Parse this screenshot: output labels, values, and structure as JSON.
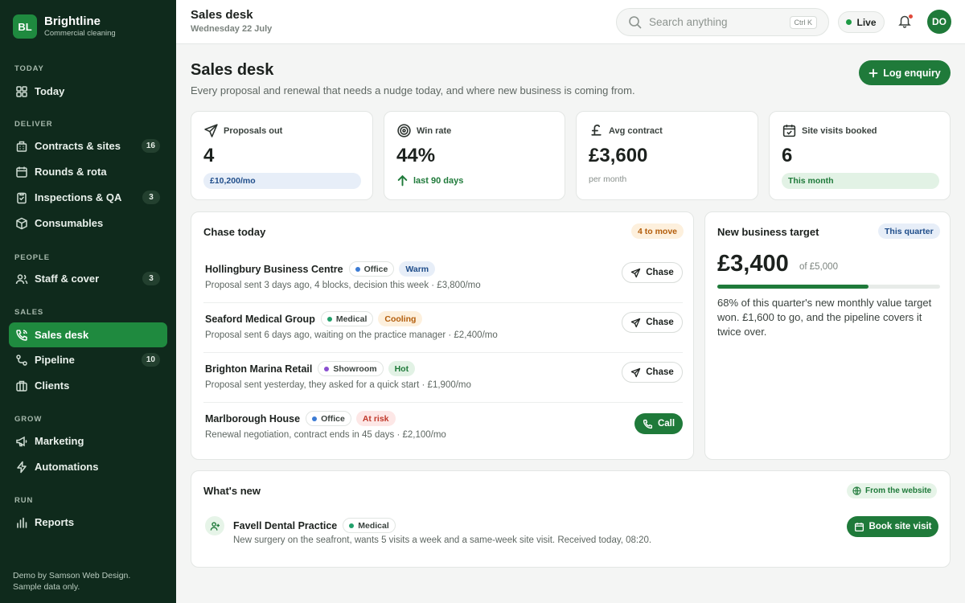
{
  "brand": {
    "initials": "BL",
    "name": "Brightline",
    "subtitle": "Commercial cleaning"
  },
  "sidebar": {
    "sections": [
      "TODAY",
      "DELIVER",
      "PEOPLE",
      "SALES",
      "GROW",
      "RUN"
    ],
    "items": [
      {
        "label": "Today",
        "icon": "grid-icon"
      },
      {
        "label": "Contracts & sites",
        "icon": "building-icon",
        "count": "16"
      },
      {
        "label": "Rounds & rota",
        "icon": "calendar-icon"
      },
      {
        "label": "Inspections & QA",
        "icon": "clipboard-icon",
        "count": "3"
      },
      {
        "label": "Consumables",
        "icon": "box-icon"
      },
      {
        "label": "Staff & cover",
        "icon": "users-icon",
        "count": "3"
      },
      {
        "label": "Sales desk",
        "icon": "phone-icon",
        "active": true
      },
      {
        "label": "Pipeline",
        "icon": "workflow-icon",
        "count": "10"
      },
      {
        "label": "Clients",
        "icon": "briefcase-icon"
      },
      {
        "label": "Marketing",
        "icon": "megaphone-icon"
      },
      {
        "label": "Automations",
        "icon": "lightning-icon"
      },
      {
        "label": "Reports",
        "icon": "bar-chart-icon"
      }
    ],
    "footer": [
      "Demo by Samson Web Design.",
      "Sample data only."
    ]
  },
  "topbar": {
    "title": "Sales desk",
    "date": "Wednesday 22 July",
    "search_placeholder": "Search anything",
    "shortcut": "Ctrl K",
    "live_label": "Live",
    "avatar": "DO"
  },
  "page": {
    "title": "Sales desk",
    "subtitle": "Every proposal and renewal that needs a nudge today, and where new business is coming from.",
    "primary_action": "Log enquiry"
  },
  "stats": [
    {
      "label": "Proposals out",
      "value": "4",
      "pill": "£10,200/mo"
    },
    {
      "label": "Win rate",
      "value": "44%",
      "trend": "last 90 days"
    },
    {
      "label": "Avg contract",
      "value": "£3,600",
      "note": "per month"
    },
    {
      "label": "Site visits booked",
      "value": "6",
      "pill": "This month"
    }
  ],
  "chase": {
    "title": "Chase today",
    "badge": "4 to move",
    "rows": [
      {
        "name": "Hollingbury Business Centre",
        "type": "Office",
        "type_color": "#3b7bd4",
        "temp": "Warm",
        "desc": "Proposal sent 3 days ago, 4 blocks, decision this week · £3,800/mo",
        "action": "Chase"
      },
      {
        "name": "Seaford Medical Group",
        "type": "Medical",
        "type_color": "#22a06b",
        "temp": "Cooling",
        "desc": "Proposal sent 6 days ago, waiting on the practice manager · £2,400/mo",
        "action": "Chase"
      },
      {
        "name": "Brighton Marina Retail",
        "type": "Showroom",
        "type_color": "#8a4fd0",
        "temp": "Hot",
        "desc": "Proposal sent yesterday, they asked for a quick start · £1,900/mo",
        "action": "Chase"
      },
      {
        "name": "Marlborough House",
        "type": "Office",
        "type_color": "#3b7bd4",
        "temp": "At risk",
        "desc": "Renewal negotiation, contract ends in 45 days · £2,100/mo",
        "action": "Call"
      }
    ]
  },
  "target": {
    "title": "New business target",
    "badge": "This quarter",
    "value": "£3,400",
    "of": "of £5,000",
    "progress": 0.68,
    "desc": "68% of this quarter's new monthly value target won. £1,600 to go, and the pipeline covers it twice over."
  },
  "news": {
    "title": "What's new",
    "badge": "From the website",
    "item": {
      "name": "Favell Dental Practice",
      "type": "Medical",
      "type_color": "#22a06b",
      "desc": "New surgery on the seafront, wants 5 visits a week and a same-week site visit. Received today, 08:20.",
      "action": "Book site visit"
    }
  },
  "colors": {
    "accent": "#1f7a3a",
    "sidebar": "#0f2a1c",
    "active_nav": "#1f8a3f"
  }
}
